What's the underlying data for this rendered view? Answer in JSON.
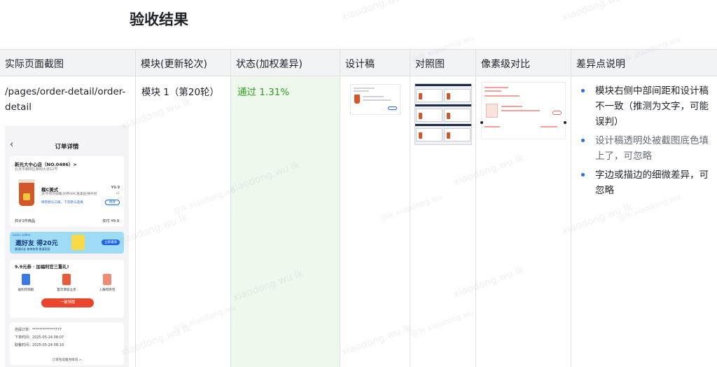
{
  "page": {
    "title": "验收结果"
  },
  "table": {
    "headers": [
      "实际页面截图",
      "模块(更新轮次)",
      "状态(加权差异)",
      "设计稿",
      "对照图",
      "像素级对比",
      "差异点说明"
    ],
    "row": {
      "path": "/pages/order-detail/order-detail",
      "module": "模块 1（第20轮）",
      "status": "通过 1.31%",
      "notes": [
        "模块右侧中部间距和设计稿不一致（推测为文字，可能误判）",
        "设计稿透明处被截图底色填上了，可忽略",
        "字边或描边的细微差异，可忽略"
      ]
    }
  },
  "screenshot": {
    "title": "订单详情",
    "store_name": "新光大中心店（NO.0486）>",
    "store_address": "北京市朝阳区朝阳大道12号",
    "product_name": "榴C美式",
    "product_desc": "冰/不另外加糖/大杯/IIAC金类豆/纯牛奶",
    "product_price": "¥9.9",
    "product_qty": "x1",
    "save_default": "保存默认口味，下次默认选择",
    "edit_btn": "修改",
    "total_label": "共计1件商品",
    "paid_label": "实付 ¥9.9",
    "banner_brand": "luckin coffee",
    "banner_main": "邀好友 得20元",
    "banner_sub": "邀请好友 每单各得 邀请奖励",
    "banner_button": "立即邀请",
    "promo_title": "9.9元券 · 加福利官三重礼!",
    "gifts": [
      "福利可领取",
      "首次添加立享",
      "入群得券包"
    ],
    "claim_button": "一键领取",
    "order_no_label": "自提订单：",
    "order_no": "*************777",
    "order_time_label": "下单时间：",
    "order_time": "2025-05-24 08:07",
    "pickup_time_label": "取餐时间：",
    "pickup_time": "2025-05-24 08:10",
    "order_link": "订单完成服务情况 >"
  },
  "watermark": {
    "text": "xiaodong.wu lk",
    "short": "@lk xiaodong.wu"
  },
  "colors": {
    "status_pass": "#2ea121",
    "status_bg": "#eef8ec",
    "header_bg": "#f2f3f5",
    "bullet": "#1f6ff2"
  }
}
